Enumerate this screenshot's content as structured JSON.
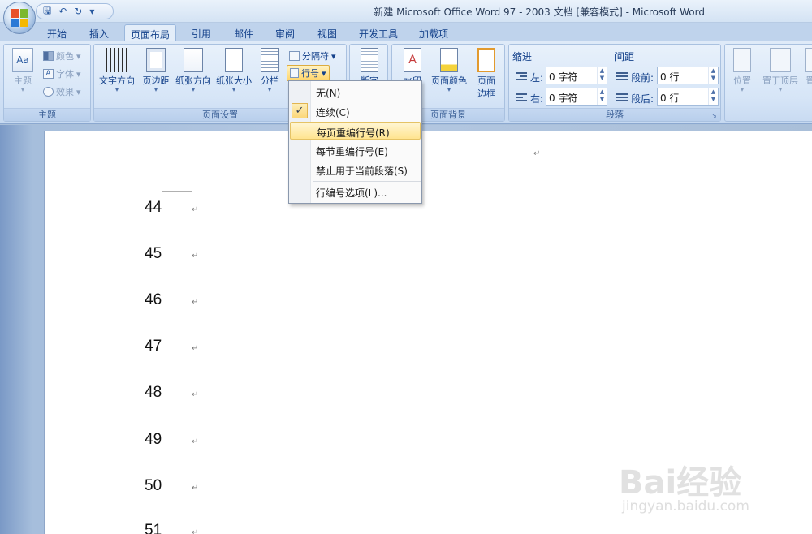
{
  "window": {
    "title": "新建 Microsoft Office Word 97 - 2003 文档 [兼容模式] - Microsoft Word"
  },
  "quick_access": {
    "items": [
      {
        "icon": "save-icon",
        "glyph": "🖫"
      },
      {
        "icon": "undo-icon",
        "glyph": "↶"
      },
      {
        "icon": "dropdown-icon",
        "glyph": "▾"
      },
      {
        "icon": "redo-icon",
        "glyph": "↻"
      }
    ],
    "customize_glyph": "⇤"
  },
  "tabs": [
    {
      "label": "开始",
      "active": false
    },
    {
      "label": "插入",
      "active": false
    },
    {
      "label": "页面布局",
      "active": true
    },
    {
      "label": "引用",
      "active": false
    },
    {
      "label": "邮件",
      "active": false
    },
    {
      "label": "审阅",
      "active": false
    },
    {
      "label": "视图",
      "active": false
    },
    {
      "label": "开发工具",
      "active": false
    },
    {
      "label": "加载项",
      "active": false
    }
  ],
  "ribbon": {
    "theme_group": {
      "label": "主题",
      "theme_button": "主题",
      "colors": "颜色",
      "fonts": "字体",
      "effects": "效果"
    },
    "page_setup_group": {
      "label": "页面设置",
      "text_direction": "文字方向",
      "margins": "页边距",
      "orientation": "纸张方向",
      "size": "纸张大小",
      "columns": "分栏",
      "breaks": "分隔符",
      "line_numbers": "行号",
      "hyphenation": "断字"
    },
    "page_background_group": {
      "label": "页面背景",
      "watermark": "水印",
      "page_color": "页面颜色",
      "page_borders_1": "页面",
      "page_borders_2": "边框"
    },
    "paragraph_group": {
      "label": "段落",
      "indent_title": "缩进",
      "spacing_title": "间距",
      "indent_left_label": "左:",
      "indent_left_value": "0 字符",
      "indent_right_label": "右:",
      "indent_right_value": "0 字符",
      "spacing_before_label": "段前:",
      "spacing_before_value": "0 行",
      "spacing_after_label": "段后:",
      "spacing_after_value": "0 行"
    },
    "arrange_group": {
      "position": "位置",
      "bring_to_front": "置于顶层",
      "send_back": "置"
    }
  },
  "line_numbers_menu": {
    "items": [
      {
        "label": "无(N)",
        "checked": false,
        "hover": false
      },
      {
        "label": "连续(C)",
        "checked": true,
        "hover": false
      },
      {
        "label": "每页重编行号(R)",
        "checked": false,
        "hover": true
      },
      {
        "label": "每节重编行号(E)",
        "checked": false,
        "hover": false
      },
      {
        "label": "禁止用于当前段落(S)",
        "checked": false,
        "hover": false
      },
      {
        "label": "行编号选项(L)...",
        "checked": false,
        "hover": false
      }
    ],
    "check_glyph": "✓"
  },
  "document": {
    "line_numbers": [
      "44",
      "45",
      "46",
      "47",
      "48",
      "49",
      "50",
      "51"
    ],
    "paragraph_mark": "↵"
  },
  "watermark": {
    "brand": "Bai经验",
    "url": "jingyan.baidu.com"
  }
}
